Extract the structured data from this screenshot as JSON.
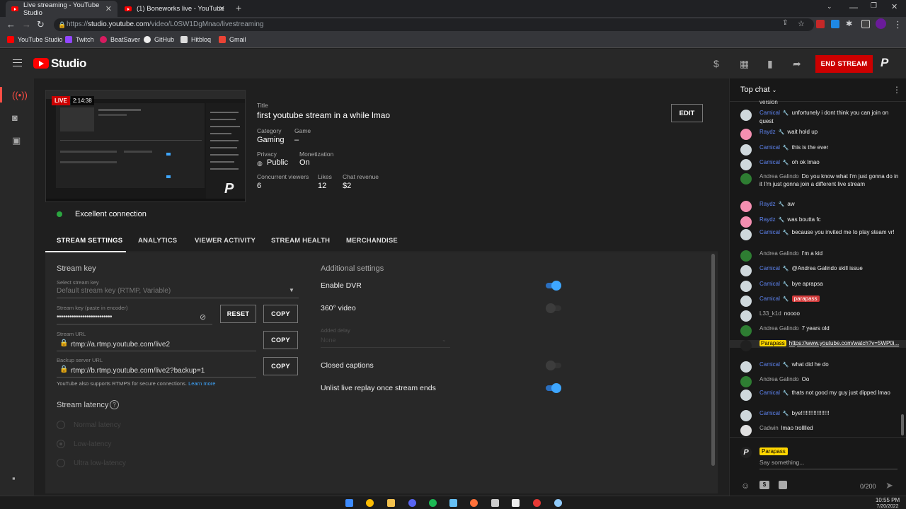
{
  "browser": {
    "tabs": [
      {
        "title": "Live streaming - YouTube Studio",
        "active": true
      },
      {
        "title": "(1) Boneworks live - YouTube",
        "active": false
      }
    ],
    "url_prefix": "https://",
    "url_domain": "studio.youtube.com",
    "url_path": "/video/L0SW1DgMnao/livestreaming",
    "bookmarks": [
      "YouTube Studio",
      "Twitch",
      "BeatSaver",
      "GitHub",
      "Hitbloq",
      "Gmail"
    ]
  },
  "header": {
    "logo": "Studio",
    "end_stream": "END STREAM"
  },
  "stream": {
    "live_badge": "LIVE",
    "elapsed": "2:14:38",
    "title_label": "Title",
    "title": "first youtube stream in a while lmao",
    "edit": "EDIT",
    "category_label": "Category",
    "category": "Gaming",
    "game_label": "Game",
    "game": "–",
    "privacy_label": "Privacy",
    "privacy": "Public",
    "monetization_label": "Monetization",
    "monetization": "On",
    "viewers_label": "Concurrent viewers",
    "viewers": "6",
    "likes_label": "Likes",
    "likes": "12",
    "revenue_label": "Chat revenue",
    "revenue": "$2",
    "connection": "Excellent connection"
  },
  "tabs": [
    "STREAM SETTINGS",
    "ANALYTICS",
    "VIEWER ACTIVITY",
    "STREAM HEALTH",
    "MERCHANDISE"
  ],
  "settings": {
    "stream_key_title": "Stream key",
    "select_key_label": "Select stream key",
    "select_key_value": "Default stream key (RTMP, Variable)",
    "key_label": "Stream key (paste in encoder)",
    "key_value": "••••••••••••••••••••••••••",
    "reset": "RESET",
    "copy": "COPY",
    "url_label": "Stream URL",
    "url_value": "rtmp://a.rtmp.youtube.com/live2",
    "backup_label": "Backup server URL",
    "backup_value": "rtmp://b.rtmp.youtube.com/live2?backup=1",
    "rtmps_note": "YouTube also supports RTMPS for secure connections.",
    "learn_more": "Learn more",
    "latency_title": "Stream latency",
    "latency_options": [
      "Normal latency",
      "Low-latency",
      "Ultra low-latency"
    ],
    "additional_title": "Additional settings",
    "enable_dvr": "Enable DVR",
    "video_360": "360° video",
    "added_delay_label": "Added delay",
    "added_delay_value": "None",
    "closed_captions": "Closed captions",
    "unlist_replay": "Unlist live replay once stream ends",
    "toggles": {
      "dvr": true,
      "video_360": false,
      "captions": false,
      "unlist": true
    }
  },
  "chat": {
    "title": "Top chat",
    "partial_top": "version",
    "messages": [
      {
        "author": "Camical",
        "type": "mod",
        "text": "unfortunely i dont think you can join on quest",
        "avatar": "#cfd8dc"
      },
      {
        "author": "Raydz",
        "type": "mod",
        "text": "wait hold up",
        "avatar": "#f48fb1"
      },
      {
        "author": "Camical",
        "type": "mod",
        "text": "this is the ever",
        "avatar": "#cfd8dc"
      },
      {
        "author": "Camical",
        "type": "mod",
        "text": "oh ok lmao",
        "avatar": "#cfd8dc"
      },
      {
        "author": "Andrea Galindo",
        "type": "normal",
        "text": "Do you know what I'm just gonna do in it I'm just gonna join a different live stream",
        "avatar": "#2e7d32"
      },
      {
        "author": "Raydz",
        "type": "mod",
        "text": "aw",
        "avatar": "#f48fb1"
      },
      {
        "author": "Raydz",
        "type": "mod",
        "text": "was boutta fc",
        "avatar": "#f48fb1"
      },
      {
        "author": "Camical",
        "type": "mod",
        "text": "because you invited me to play steam vr!",
        "avatar": "#cfd8dc"
      },
      {
        "author": "Andrea Galindo",
        "type": "normal",
        "text": "I'm a kid",
        "avatar": "#2e7d32"
      },
      {
        "author": "Camical",
        "type": "mod",
        "text": "@Andrea Galindo skill issue",
        "avatar": "#cfd8dc"
      },
      {
        "author": "Camical",
        "type": "mod",
        "text": "bye aprapsa",
        "avatar": "#cfd8dc"
      },
      {
        "author": "Camical",
        "type": "mod",
        "text": "parapass",
        "avatar": "#cfd8dc"
      },
      {
        "author": "L33_k1d",
        "type": "normal",
        "text": "noooo",
        "avatar": "#cfd8dc"
      },
      {
        "author": "Andrea Galindo",
        "type": "normal",
        "text": "7 years old",
        "avatar": "#2e7d32"
      },
      {
        "author": "Parapass",
        "type": "owner",
        "text": "https://www.youtube.com/watch?v=5WP0i...",
        "avatar": "#202020"
      },
      {
        "author": "Camical",
        "type": "mod",
        "text": "what did he do",
        "avatar": "#cfd8dc"
      },
      {
        "author": "Andrea Galindo",
        "type": "normal",
        "text": "Oo",
        "avatar": "#2e7d32"
      },
      {
        "author": "Camical",
        "type": "mod",
        "text": "thats not good my guy just dipped lmao",
        "avatar": "#cfd8dc"
      },
      {
        "author": "Camical",
        "type": "mod",
        "text": "bye!!!!!!!!!!!!!!!!!!",
        "avatar": "#cfd8dc"
      },
      {
        "author": "Cadwin",
        "type": "normal",
        "text": "lmao trolllled",
        "avatar": "#e0e0e0"
      }
    ],
    "input_author": "Parapass",
    "input_placeholder": "Say something...",
    "counter": "0/200"
  },
  "taskbar": {
    "time": "10:55 PM",
    "date": "7/20/2022"
  }
}
